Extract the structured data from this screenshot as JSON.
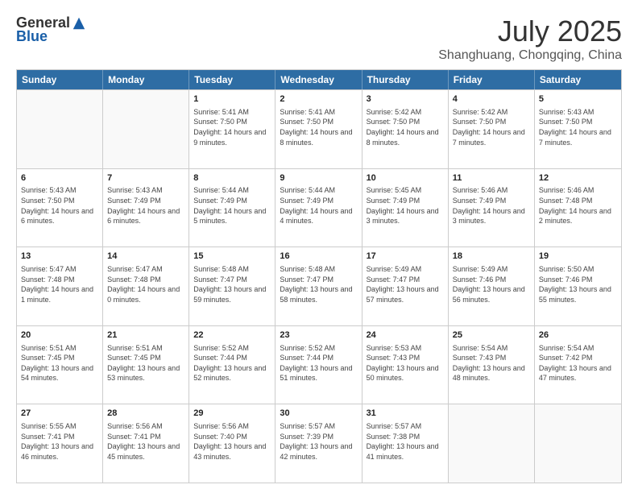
{
  "header": {
    "logo_general": "General",
    "logo_blue": "Blue",
    "month": "July 2025",
    "location": "Shanghuang, Chongqing, China"
  },
  "weekdays": [
    "Sunday",
    "Monday",
    "Tuesday",
    "Wednesday",
    "Thursday",
    "Friday",
    "Saturday"
  ],
  "weeks": [
    [
      {
        "day": "",
        "sunrise": "",
        "sunset": "",
        "daylight": ""
      },
      {
        "day": "",
        "sunrise": "",
        "sunset": "",
        "daylight": ""
      },
      {
        "day": "1",
        "sunrise": "Sunrise: 5:41 AM",
        "sunset": "Sunset: 7:50 PM",
        "daylight": "Daylight: 14 hours and 9 minutes."
      },
      {
        "day": "2",
        "sunrise": "Sunrise: 5:41 AM",
        "sunset": "Sunset: 7:50 PM",
        "daylight": "Daylight: 14 hours and 8 minutes."
      },
      {
        "day": "3",
        "sunrise": "Sunrise: 5:42 AM",
        "sunset": "Sunset: 7:50 PM",
        "daylight": "Daylight: 14 hours and 8 minutes."
      },
      {
        "day": "4",
        "sunrise": "Sunrise: 5:42 AM",
        "sunset": "Sunset: 7:50 PM",
        "daylight": "Daylight: 14 hours and 7 minutes."
      },
      {
        "day": "5",
        "sunrise": "Sunrise: 5:43 AM",
        "sunset": "Sunset: 7:50 PM",
        "daylight": "Daylight: 14 hours and 7 minutes."
      }
    ],
    [
      {
        "day": "6",
        "sunrise": "Sunrise: 5:43 AM",
        "sunset": "Sunset: 7:50 PM",
        "daylight": "Daylight: 14 hours and 6 minutes."
      },
      {
        "day": "7",
        "sunrise": "Sunrise: 5:43 AM",
        "sunset": "Sunset: 7:49 PM",
        "daylight": "Daylight: 14 hours and 6 minutes."
      },
      {
        "day": "8",
        "sunrise": "Sunrise: 5:44 AM",
        "sunset": "Sunset: 7:49 PM",
        "daylight": "Daylight: 14 hours and 5 minutes."
      },
      {
        "day": "9",
        "sunrise": "Sunrise: 5:44 AM",
        "sunset": "Sunset: 7:49 PM",
        "daylight": "Daylight: 14 hours and 4 minutes."
      },
      {
        "day": "10",
        "sunrise": "Sunrise: 5:45 AM",
        "sunset": "Sunset: 7:49 PM",
        "daylight": "Daylight: 14 hours and 3 minutes."
      },
      {
        "day": "11",
        "sunrise": "Sunrise: 5:46 AM",
        "sunset": "Sunset: 7:49 PM",
        "daylight": "Daylight: 14 hours and 3 minutes."
      },
      {
        "day": "12",
        "sunrise": "Sunrise: 5:46 AM",
        "sunset": "Sunset: 7:48 PM",
        "daylight": "Daylight: 14 hours and 2 minutes."
      }
    ],
    [
      {
        "day": "13",
        "sunrise": "Sunrise: 5:47 AM",
        "sunset": "Sunset: 7:48 PM",
        "daylight": "Daylight: 14 hours and 1 minute."
      },
      {
        "day": "14",
        "sunrise": "Sunrise: 5:47 AM",
        "sunset": "Sunset: 7:48 PM",
        "daylight": "Daylight: 14 hours and 0 minutes."
      },
      {
        "day": "15",
        "sunrise": "Sunrise: 5:48 AM",
        "sunset": "Sunset: 7:47 PM",
        "daylight": "Daylight: 13 hours and 59 minutes."
      },
      {
        "day": "16",
        "sunrise": "Sunrise: 5:48 AM",
        "sunset": "Sunset: 7:47 PM",
        "daylight": "Daylight: 13 hours and 58 minutes."
      },
      {
        "day": "17",
        "sunrise": "Sunrise: 5:49 AM",
        "sunset": "Sunset: 7:47 PM",
        "daylight": "Daylight: 13 hours and 57 minutes."
      },
      {
        "day": "18",
        "sunrise": "Sunrise: 5:49 AM",
        "sunset": "Sunset: 7:46 PM",
        "daylight": "Daylight: 13 hours and 56 minutes."
      },
      {
        "day": "19",
        "sunrise": "Sunrise: 5:50 AM",
        "sunset": "Sunset: 7:46 PM",
        "daylight": "Daylight: 13 hours and 55 minutes."
      }
    ],
    [
      {
        "day": "20",
        "sunrise": "Sunrise: 5:51 AM",
        "sunset": "Sunset: 7:45 PM",
        "daylight": "Daylight: 13 hours and 54 minutes."
      },
      {
        "day": "21",
        "sunrise": "Sunrise: 5:51 AM",
        "sunset": "Sunset: 7:45 PM",
        "daylight": "Daylight: 13 hours and 53 minutes."
      },
      {
        "day": "22",
        "sunrise": "Sunrise: 5:52 AM",
        "sunset": "Sunset: 7:44 PM",
        "daylight": "Daylight: 13 hours and 52 minutes."
      },
      {
        "day": "23",
        "sunrise": "Sunrise: 5:52 AM",
        "sunset": "Sunset: 7:44 PM",
        "daylight": "Daylight: 13 hours and 51 minutes."
      },
      {
        "day": "24",
        "sunrise": "Sunrise: 5:53 AM",
        "sunset": "Sunset: 7:43 PM",
        "daylight": "Daylight: 13 hours and 50 minutes."
      },
      {
        "day": "25",
        "sunrise": "Sunrise: 5:54 AM",
        "sunset": "Sunset: 7:43 PM",
        "daylight": "Daylight: 13 hours and 48 minutes."
      },
      {
        "day": "26",
        "sunrise": "Sunrise: 5:54 AM",
        "sunset": "Sunset: 7:42 PM",
        "daylight": "Daylight: 13 hours and 47 minutes."
      }
    ],
    [
      {
        "day": "27",
        "sunrise": "Sunrise: 5:55 AM",
        "sunset": "Sunset: 7:41 PM",
        "daylight": "Daylight: 13 hours and 46 minutes."
      },
      {
        "day": "28",
        "sunrise": "Sunrise: 5:56 AM",
        "sunset": "Sunset: 7:41 PM",
        "daylight": "Daylight: 13 hours and 45 minutes."
      },
      {
        "day": "29",
        "sunrise": "Sunrise: 5:56 AM",
        "sunset": "Sunset: 7:40 PM",
        "daylight": "Daylight: 13 hours and 43 minutes."
      },
      {
        "day": "30",
        "sunrise": "Sunrise: 5:57 AM",
        "sunset": "Sunset: 7:39 PM",
        "daylight": "Daylight: 13 hours and 42 minutes."
      },
      {
        "day": "31",
        "sunrise": "Sunrise: 5:57 AM",
        "sunset": "Sunset: 7:38 PM",
        "daylight": "Daylight: 13 hours and 41 minutes."
      },
      {
        "day": "",
        "sunrise": "",
        "sunset": "",
        "daylight": ""
      },
      {
        "day": "",
        "sunrise": "",
        "sunset": "",
        "daylight": ""
      }
    ]
  ]
}
